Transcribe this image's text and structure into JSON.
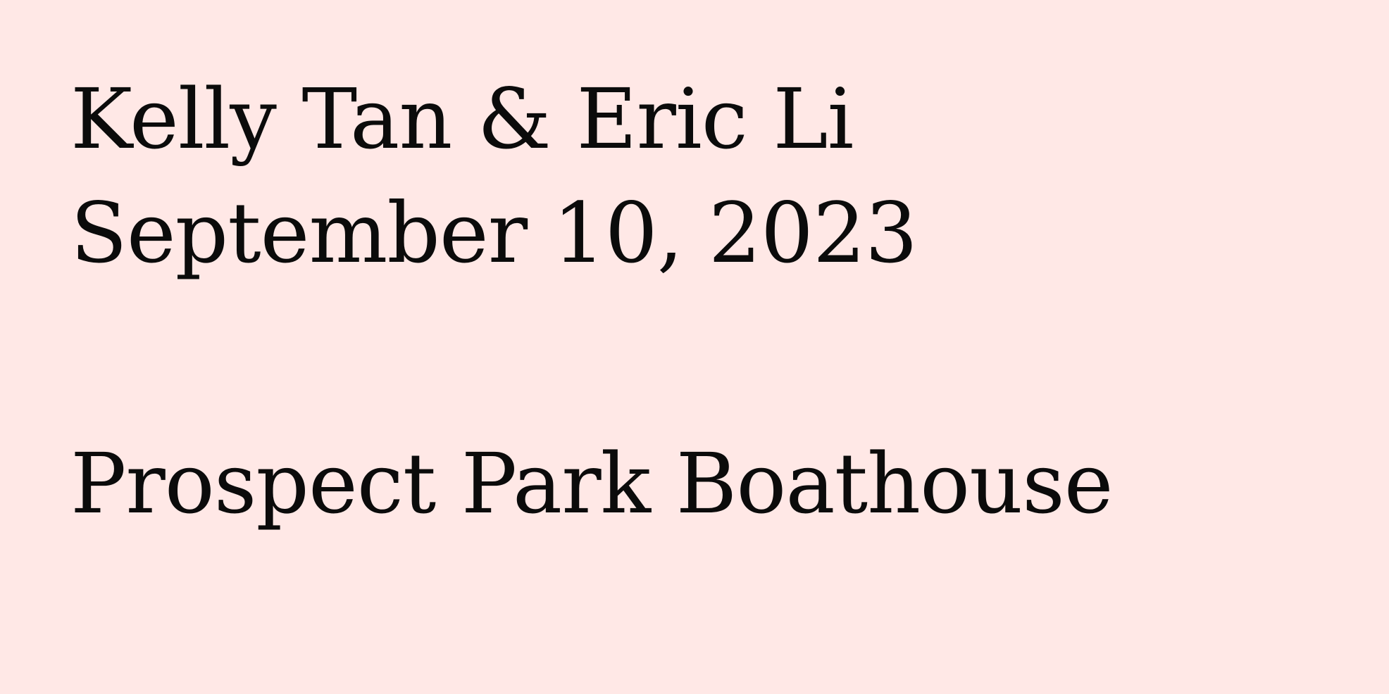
{
  "invitation": {
    "couple": "Kelly Tan & Eric Li",
    "date": "September 10, 2023",
    "venue": "Prospect Park Boathouse"
  },
  "colors": {
    "background": "#ffe8e6",
    "text": "#0b0b0b"
  }
}
